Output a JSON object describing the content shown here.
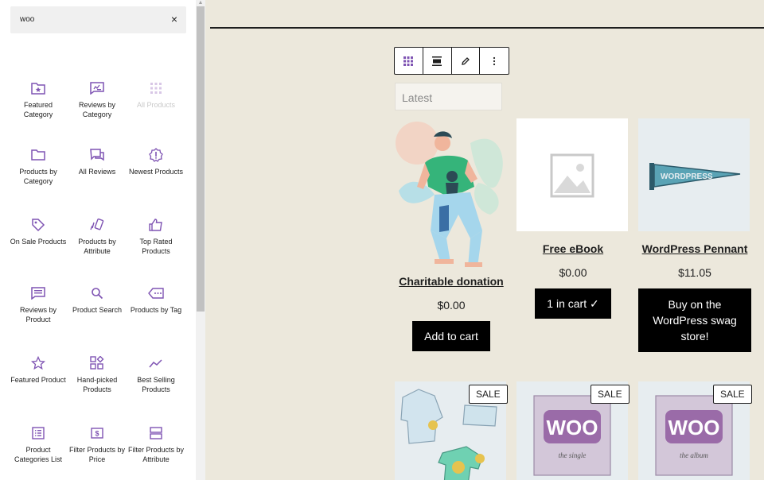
{
  "search": {
    "value": "woo",
    "close_glyph": "×"
  },
  "blocks": [
    {
      "label": "Featured Category",
      "icon": "folder-star-icon"
    },
    {
      "label": "Reviews by Category",
      "icon": "review-icon"
    },
    {
      "label": "All Products",
      "icon": "grid-icon",
      "disabled": true
    },
    {
      "label": "Products by Category",
      "icon": "folder-icon"
    },
    {
      "label": "All Reviews",
      "icon": "chat-icon"
    },
    {
      "label": "Newest Products",
      "icon": "exclamation-icon"
    },
    {
      "label": "On Sale Products",
      "icon": "tag-icon"
    },
    {
      "label": "Products by Attribute",
      "icon": "cards-icon"
    },
    {
      "label": "Top Rated Products",
      "icon": "thumbs-up-icon"
    },
    {
      "label": "Reviews by Product",
      "icon": "comment-lines-icon"
    },
    {
      "label": "Product Search",
      "icon": "search-icon"
    },
    {
      "label": "Products by Tag",
      "icon": "tag-dots-icon"
    },
    {
      "label": "Featured Product",
      "icon": "star-icon"
    },
    {
      "label": "Hand-picked Products",
      "icon": "widgets-icon"
    },
    {
      "label": "Best Selling Products",
      "icon": "trend-icon"
    },
    {
      "label": "Product Categories List",
      "icon": "list-icon"
    },
    {
      "label": "Filter Products by Price",
      "icon": "dollar-icon"
    },
    {
      "label": "Filter Products by Attribute",
      "icon": "filter-icon"
    }
  ],
  "toolbar": {
    "items": [
      "grid-icon",
      "align-icon",
      "pencil-icon",
      "more-icon"
    ]
  },
  "select": {
    "value": "Latest"
  },
  "products": [
    {
      "title": "Charitable donation",
      "price": "$0.00",
      "button": "Add to cart",
      "image": "donation-illustration"
    },
    {
      "title": "Free eBook",
      "price": "$0.00",
      "button": "1 in cart ✓",
      "image": "placeholder-image"
    },
    {
      "title": "WordPress Pennant",
      "price": "$11.05",
      "button": "Buy on the WordPress swag store!",
      "image": "pennant-image",
      "pennant_text": "WORDPRESS"
    }
  ],
  "sale_items": [
    {
      "badge": "SALE",
      "image": "hoodie-image"
    },
    {
      "badge": "SALE",
      "image": "woo-single-image",
      "logo": "WOO",
      "caption": "the single"
    },
    {
      "badge": "SALE",
      "image": "woo-album-image",
      "logo": "WOO",
      "caption": "the album"
    }
  ],
  "colors": {
    "accent": "#7f54b3",
    "canvas": "#ece8dc",
    "button": "#000000"
  }
}
